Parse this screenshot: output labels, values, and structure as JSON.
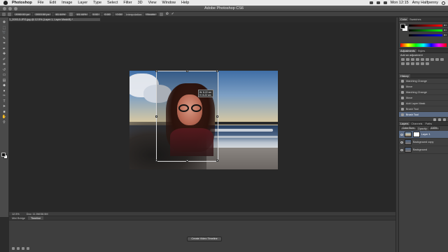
{
  "menubar": {
    "app": "Photoshop",
    "items": [
      "File",
      "Edit",
      "Image",
      "Layer",
      "Type",
      "Select",
      "Filter",
      "3D",
      "View",
      "Window",
      "Help"
    ],
    "clock": "Mon 12:15",
    "user": "Amy Halfpenny"
  },
  "window": {
    "title": "Adobe Photoshop CS6"
  },
  "options": {
    "x": "2050.00 px",
    "y": "2053.50 px",
    "w": "81.44%",
    "h": "81.44%",
    "angle": "0.00",
    "hskew": "0.00",
    "vskew": "0.00",
    "interpolation_label": "Interpolation:",
    "interpolation_value": "Bicubic",
    "commit": "✓",
    "cancel": "⊘"
  },
  "document": {
    "tab_title": "IMG_2093-3.JPG.jpg @ 12.5% (Layer 1, Layer Mask/8) *"
  },
  "transform_tooltip": {
    "w": "W: 8.22 cm",
    "h": "H: 8.22 cm"
  },
  "statusbar": {
    "zoom": "12.5%",
    "doc": "Doc: 11.5M/38.5M"
  },
  "timeline": {
    "tabs": [
      "Mini Bridge",
      "Timeline"
    ],
    "active_tab": 1,
    "create_button": "Create Video Timeline"
  },
  "panels": {
    "color_tabs": [
      "Color",
      "Swatches"
    ],
    "color_values": [
      "0",
      "0",
      "0"
    ],
    "adjust_tabs": [
      "Adjustments",
      "Styles"
    ],
    "adjust_title": "Add an adjustment",
    "history_tab": "History",
    "history_items": [
      {
        "label": "Marching Change",
        "selected": false
      },
      {
        "label": "Move",
        "selected": false
      },
      {
        "label": "Marching Change",
        "selected": false
      },
      {
        "label": "Move",
        "selected": false
      },
      {
        "label": "Add Layer Mask",
        "selected": false
      },
      {
        "label": "Brush Tool",
        "selected": false
      },
      {
        "label": "Brush Tool",
        "selected": true
      }
    ],
    "layers_tabs": [
      "Layers",
      "Channels",
      "Paths"
    ],
    "blend_mode": "Color Burn",
    "opacity_label": "Opacity:",
    "opacity_value": "100%",
    "layers": [
      {
        "name": "Layer 1",
        "selected": true,
        "thumb": "photo",
        "mask": true
      },
      {
        "name": "Background copy",
        "selected": false,
        "thumb": "dark",
        "mask": false
      },
      {
        "name": "Background",
        "selected": false,
        "thumb": "dark",
        "mask": false
      }
    ]
  },
  "tools": [
    "move",
    "marquee",
    "lasso",
    "quick-select",
    "crop",
    "eyedropper",
    "healing",
    "brush",
    "clone",
    "history-brush",
    "eraser",
    "gradient",
    "blur",
    "dodge",
    "pen",
    "type",
    "path-select",
    "shape",
    "hand",
    "zoom"
  ],
  "colors": {
    "accent": "#5a6a83",
    "panel": "#3f3f3f",
    "canvas": "#282828"
  }
}
